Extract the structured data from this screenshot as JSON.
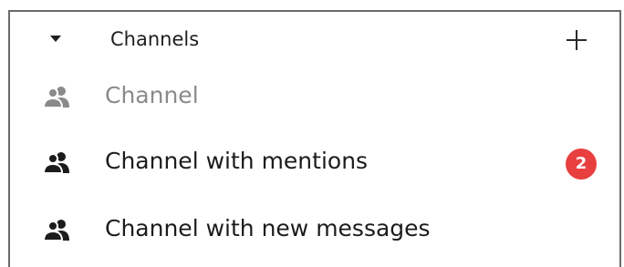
{
  "section": {
    "title": "Channels",
    "add_icon": "plus-icon",
    "collapse_icon": "caret-down-icon"
  },
  "channels": [
    {
      "label": "Channel",
      "icon": "group-icon",
      "state": "read",
      "badge": ""
    },
    {
      "label": "Channel with mentions",
      "icon": "group-icon",
      "state": "unread",
      "badge": "2"
    },
    {
      "label": "Channel with new messages",
      "icon": "group-icon",
      "state": "unread",
      "badge": ""
    }
  ],
  "colors": {
    "badge": "#e8403f",
    "muted_text": "#8a8a8a",
    "strong_text": "#1c1c1c"
  }
}
